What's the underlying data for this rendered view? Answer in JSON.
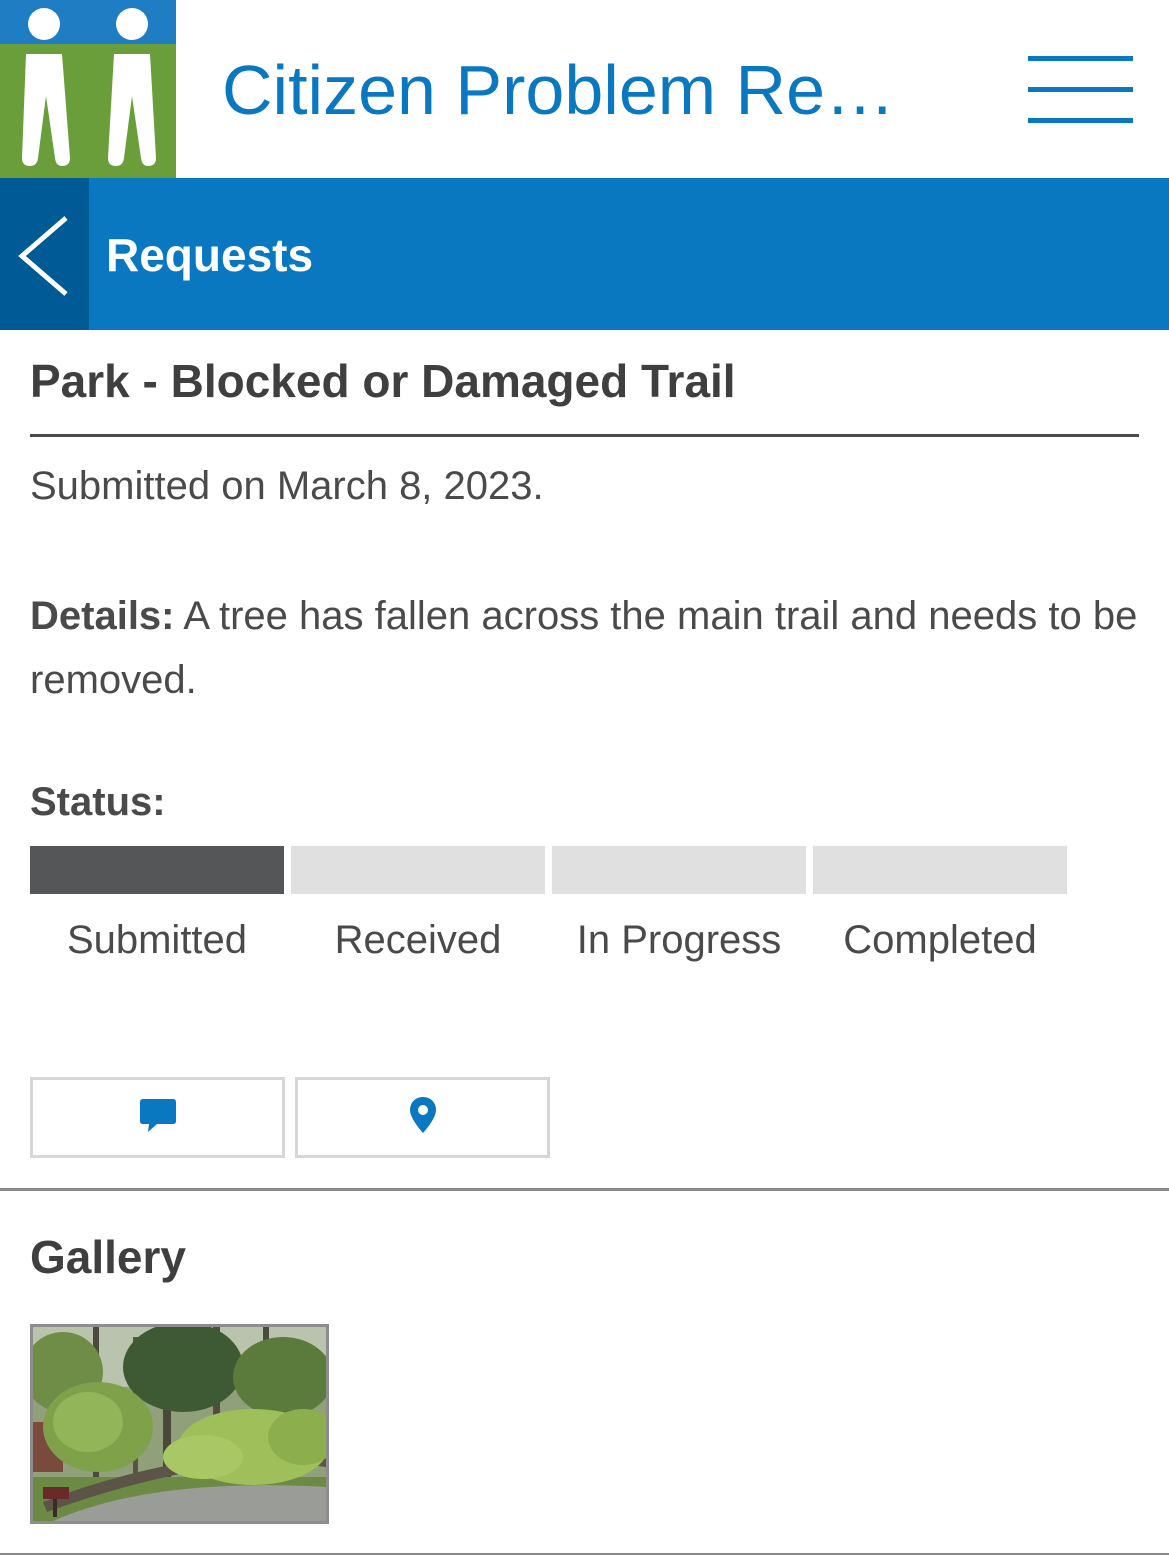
{
  "header": {
    "app_title": "Citizen Problem Re…",
    "logo_icon": "people-logo",
    "menu_icon": "hamburger-menu-icon"
  },
  "nav": {
    "back_icon": "chevron-left-icon",
    "title": "Requests"
  },
  "request": {
    "title": "Park - Blocked or Damaged Trail",
    "submitted_text": "Submitted on March 8, 2023.",
    "details_label": "Details:",
    "details_text": " A tree has fallen across the main trail and needs to be removed.",
    "status_label": "Status:",
    "status_steps": [
      {
        "label": "Submitted",
        "active": true
      },
      {
        "label": "Received",
        "active": false
      },
      {
        "label": "In Progress",
        "active": false
      },
      {
        "label": "Completed",
        "active": false
      }
    ],
    "current_step_index": 0
  },
  "actions": [
    {
      "icon": "comment-icon"
    },
    {
      "icon": "map-pin-icon"
    }
  ],
  "gallery": {
    "heading": "Gallery",
    "photo": "fallen-tree-photo"
  },
  "colors": {
    "brand_blue": "#0a78c1",
    "nav_dark_blue": "#005a96",
    "logo_green": "#6a9e3a",
    "status_active": "#555658",
    "status_inactive": "#e0e0e0"
  }
}
